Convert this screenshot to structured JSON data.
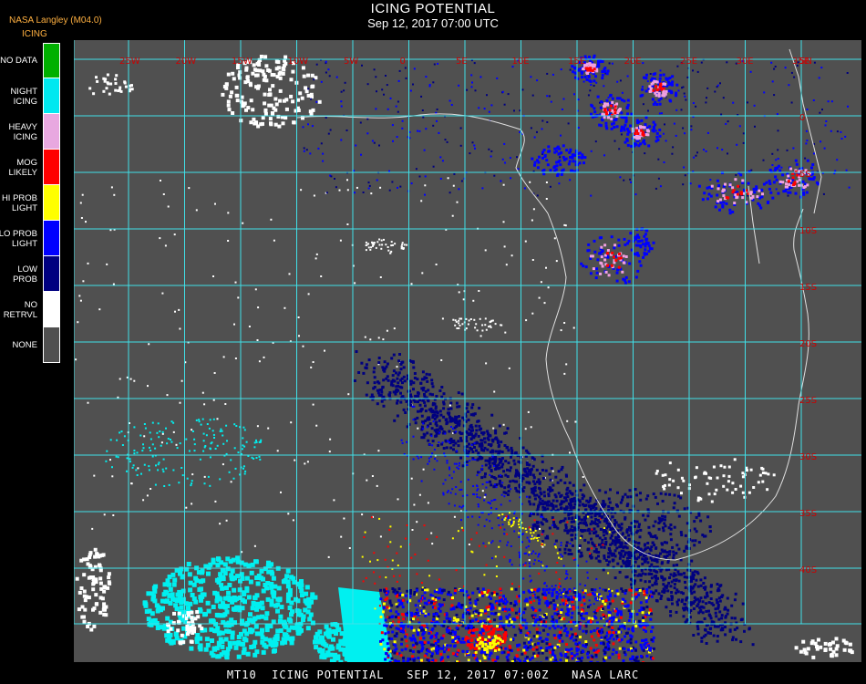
{
  "header": {
    "title": "ICING POTENTIAL",
    "datetime": "Sep 12, 2017 07:00 UTC",
    "credit": "NASA Langley (M04.0)",
    "legend_title": "ICING"
  },
  "legend": [
    {
      "label": "NO DATA",
      "color": "#00b000"
    },
    {
      "label": "NIGHT\nICING",
      "color": "#00e8f0"
    },
    {
      "label": "HEAVY\nICING",
      "color": "#e8a8e0"
    },
    {
      "label": "MOG\nLIKELY",
      "color": "#ff0000"
    },
    {
      "label": "HI PROB\nLIGHT",
      "color": "#ffff00"
    },
    {
      "label": "LO PROB\nLIGHT",
      "color": "#0000ff"
    },
    {
      "label": "LOW\nPROB",
      "color": "#000080"
    },
    {
      "label": "NO\nRETRVL",
      "color": "#ffffff"
    },
    {
      "label": "NONE",
      "color": "#505050"
    }
  ],
  "map": {
    "background": "#505050",
    "grid_color": "#40e0e8",
    "coast_color": "#e0e0e0",
    "grid_label_color": "#cc0000",
    "lon_labels": [
      "25W",
      "20W",
      "15W",
      "10W",
      "5W",
      "0",
      "5E",
      "10E",
      "15E",
      "20E",
      "25E",
      "30E",
      "35E"
    ],
    "lat_labels": [
      "5N",
      "0",
      "5S",
      "10S",
      "15S",
      "20S",
      "25S",
      "30S",
      "35S",
      "40S"
    ]
  },
  "footer": "MT10  ICING POTENTIAL   SEP 12, 2017 07:00Z   NASA LARC"
}
